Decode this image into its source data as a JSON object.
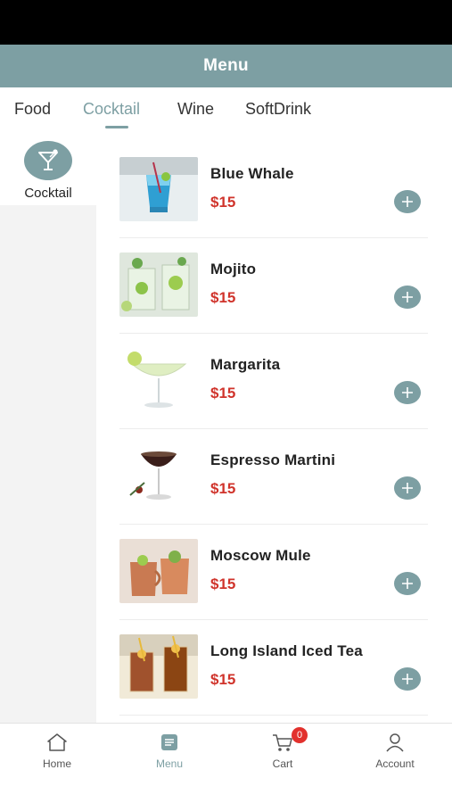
{
  "header": {
    "title": "Menu"
  },
  "tabs": [
    {
      "label": "Food"
    },
    {
      "label": "Cocktail"
    },
    {
      "label": "Wine"
    },
    {
      "label": "SoftDrink"
    }
  ],
  "active_tab": "Cocktail",
  "sidebar": {
    "items": [
      {
        "label": "Cocktail",
        "icon": "cocktail-glass-icon"
      }
    ]
  },
  "items": [
    {
      "name": "Blue Whale",
      "price": "$15",
      "image": "blue-cocktail-photo"
    },
    {
      "name": "Mojito",
      "price": "$15",
      "image": "mojito-photo"
    },
    {
      "name": "Margarita",
      "price": "$15",
      "image": "margarita-photo"
    },
    {
      "name": "Espresso Martini",
      "price": "$15",
      "image": "espresso-martini-photo"
    },
    {
      "name": "Moscow Mule",
      "price": "$15",
      "image": "moscow-mule-photo"
    },
    {
      "name": "Long Island Iced Tea",
      "price": "$15",
      "image": "long-island-photo"
    }
  ],
  "bottom_nav": [
    {
      "label": "Home",
      "icon": "home-icon"
    },
    {
      "label": "Menu",
      "icon": "menu-icon"
    },
    {
      "label": "Cart",
      "icon": "cart-icon",
      "badge": "0"
    },
    {
      "label": "Account",
      "icon": "account-icon"
    }
  ],
  "active_nav": "Menu",
  "colors": {
    "accent": "#7d9fa3",
    "price": "#d0342c",
    "badge": "#e2312d"
  }
}
